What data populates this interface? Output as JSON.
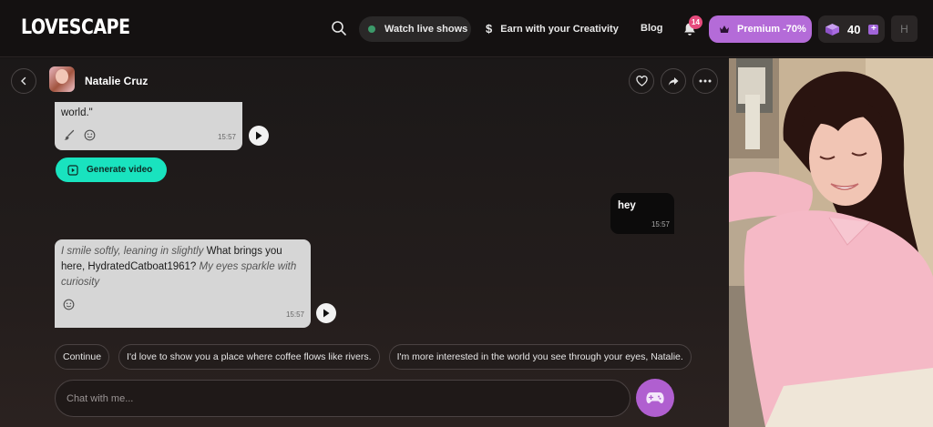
{
  "topbar": {
    "logo": "LOVESCAPE",
    "live_label": "Watch live shows",
    "earn_label": "Earn with your Creativity",
    "blog_label": "Blog",
    "notification_count": "14",
    "premium_label": "Premium -70%",
    "gems_count": "40",
    "user_initial": "H"
  },
  "chat": {
    "contact_name": "Natalie Cruz",
    "messages": [
      {
        "sender": "bot",
        "text": "world.\"",
        "time": "15:57"
      },
      {
        "sender": "user",
        "text": "hey",
        "time": "15:57"
      },
      {
        "sender": "bot",
        "italic_1": "I smile softly, leaning in slightly",
        "normal_1": " What brings you here, HydratedCatboat1961? ",
        "italic_2": "My eyes sparkle with curiosity",
        "time": "15:57"
      }
    ],
    "generate_video_label": "Generate video",
    "suggestions": [
      "Continue",
      "I'd love to show you a place where coffee flows like rivers.",
      "I'm more interested in the world you see through your eyes, Natalie."
    ],
    "input_placeholder": "Chat with me..."
  },
  "colors": {
    "accent_purple": "#b46bd8",
    "accent_teal": "#19e3bf",
    "badge_pink": "#e64b7d"
  },
  "icons": [
    "search-icon",
    "bell-icon",
    "crown-icon",
    "gem-icon",
    "back-icon",
    "heart-icon",
    "share-icon",
    "more-icon",
    "brush-icon",
    "emoji-icon",
    "play-icon",
    "video-icon",
    "gamepad-icon"
  ]
}
